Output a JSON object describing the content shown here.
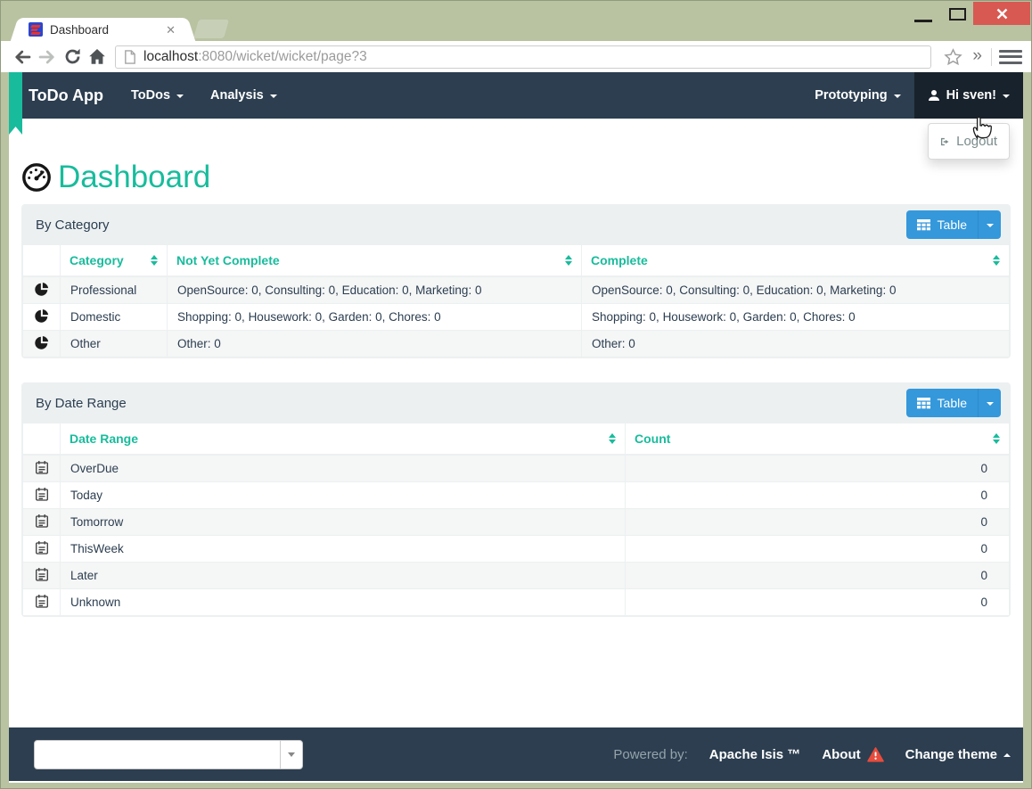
{
  "browser": {
    "tab_title": "Dashboard",
    "url": {
      "host": "localhost",
      "rest": ":8080/wicket/wicket/page?3"
    },
    "window_controls": [
      "minimize",
      "maximize",
      "close"
    ]
  },
  "navbar": {
    "brand": "ToDo App",
    "menu_todos": "ToDos",
    "menu_analysis": "Analysis",
    "menu_prototyping": "Prototyping",
    "user_label": "Hi sven!",
    "logout_label": "Logout"
  },
  "page": {
    "title": "Dashboard"
  },
  "panels": [
    {
      "title": "By Category",
      "button_label": "Table",
      "columns": [
        "Category",
        "Not Yet Complete",
        "Complete"
      ],
      "row_icon": "pie-chart-icon",
      "rows": [
        [
          "Professional",
          "OpenSource: 0, Consulting: 0, Education: 0, Marketing: 0",
          "OpenSource: 0, Consulting: 0, Education: 0, Marketing: 0"
        ],
        [
          "Domestic",
          "Shopping: 0, Housework: 0, Garden: 0, Chores: 0",
          "Shopping: 0, Housework: 0, Garden: 0, Chores: 0"
        ],
        [
          "Other",
          "Other: 0",
          "Other: 0"
        ]
      ]
    },
    {
      "title": "By Date Range",
      "button_label": "Table",
      "columns": [
        "Date Range",
        "Count"
      ],
      "row_icon": "calendar-icon",
      "rows": [
        [
          "OverDue",
          "0"
        ],
        [
          "Today",
          "0"
        ],
        [
          "Tomorrow",
          "0"
        ],
        [
          "ThisWeek",
          "0"
        ],
        [
          "Later",
          "0"
        ],
        [
          "Unknown",
          "0"
        ]
      ]
    }
  ],
  "footer": {
    "powered_by": "Powered by:",
    "brand": "Apache Isis ™",
    "about": "About",
    "change_theme": "Change theme"
  },
  "icons": {
    "dashboard-icon": "tachometer gauge",
    "pie-chart-icon": "pie chart",
    "calendar-icon": "calendar",
    "user-icon": "person",
    "logout-icon": "sign-out",
    "table-icon": "grid table",
    "warning-icon": "red warning triangle"
  },
  "colors": {
    "accent_teal": "#18bc9c",
    "navbar_bg": "#2c3e50",
    "primary_blue": "#3498db",
    "danger_red": "#e74c3c",
    "window_frame": "#b9c3a2",
    "close_button_red": "#d75952"
  }
}
